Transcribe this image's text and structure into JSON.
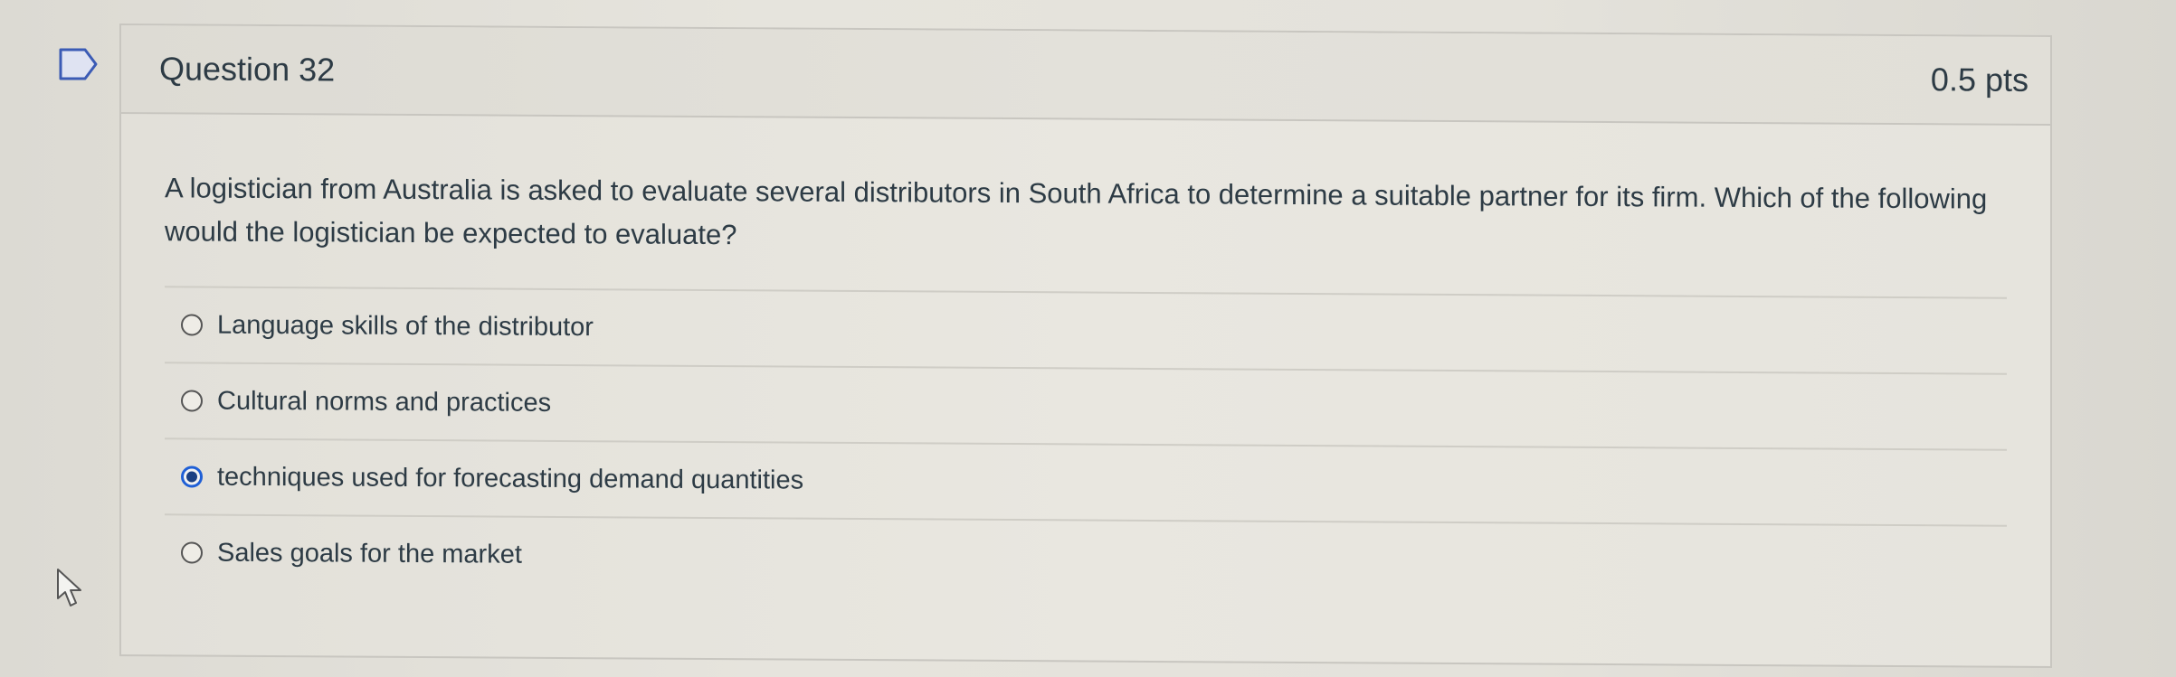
{
  "question": {
    "title": "Question 32",
    "points": "0.5 pts",
    "text": "A logistician from Australia is asked to evaluate several distributors in South Africa to determine a suitable partner for its firm. Which of the following would the logistician be expected to evaluate?"
  },
  "answers": [
    {
      "label": "Language skills of the distributor",
      "selected": false
    },
    {
      "label": "Cultural norms and practices",
      "selected": false
    },
    {
      "label": "techniques used for forecasting demand quantities",
      "selected": true
    },
    {
      "label": "Sales goals for the market",
      "selected": false
    }
  ],
  "icons": {
    "flag": "flag-icon",
    "cursor": "mouse-pointer-icon"
  },
  "colors": {
    "selected_radio": "#1f5fd6",
    "text": "#2d3b45",
    "border": "#c8c6c0"
  }
}
